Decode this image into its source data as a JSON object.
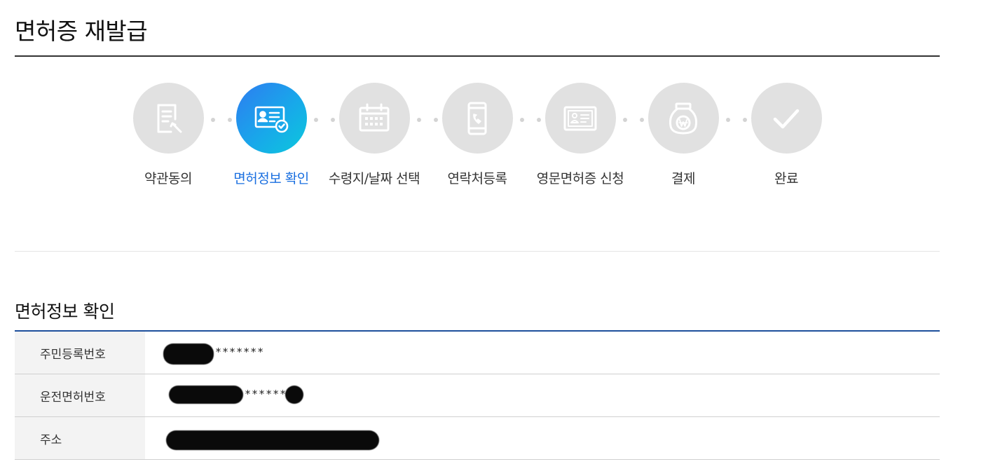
{
  "page": {
    "title": "면허증 재발급"
  },
  "steps": [
    {
      "label": "약관동의",
      "icon": "document-pen-icon",
      "active": false
    },
    {
      "label": "면허정보 확인",
      "icon": "id-card-check-icon",
      "active": true
    },
    {
      "label": "수령지/날짜 선택",
      "icon": "calendar-icon",
      "active": false
    },
    {
      "label": "연락처등록",
      "icon": "smartphone-icon",
      "active": false
    },
    {
      "label": "영문면허증 신청",
      "icon": "id-card-icon",
      "active": false
    },
    {
      "label": "결제",
      "icon": "money-bag-won-icon",
      "active": false
    },
    {
      "label": "완료",
      "icon": "checkmark-icon",
      "active": false
    }
  ],
  "section": {
    "title": "면허정보 확인"
  },
  "info": {
    "rows": [
      {
        "label": "주민등록번호",
        "value_suffix": "*******"
      },
      {
        "label": "운전면허번호",
        "value_suffix": "******"
      },
      {
        "label": "주소",
        "value_suffix": ""
      }
    ]
  },
  "colors": {
    "accent": "#1a6fe0",
    "table_border": "#1d4f9c",
    "step_inactive": "#e1e1e1"
  }
}
